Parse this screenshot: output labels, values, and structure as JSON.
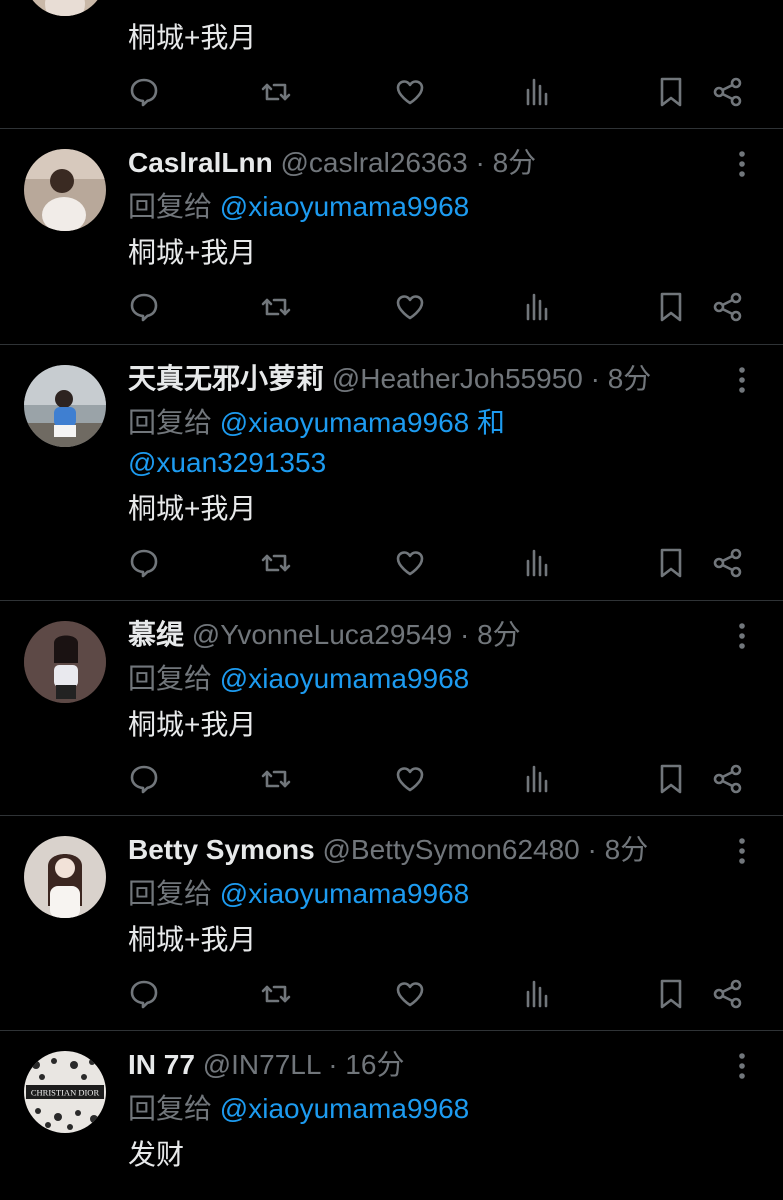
{
  "colors": {
    "background": "#000000",
    "text": "#e7e9ea",
    "muted": "#71767b",
    "link": "#1d9bf0",
    "divider": "#2f3336"
  },
  "top_partial": {
    "text": "桐城+我月"
  },
  "replies": [
    {
      "name": "CaslralLnn",
      "handle": "@caslral26363",
      "separator": "·",
      "time": "8分",
      "reply_prefix": "回复给",
      "mentions": [
        "@xiaoyumama9968"
      ],
      "text": "桐城+我月"
    },
    {
      "name": "天真无邪小萝莉",
      "handle": "@HeatherJoh55950",
      "separator": "·",
      "time": "8分",
      "reply_prefix": "回复给",
      "mentions": [
        "@xiaoyumama9968",
        "@xuan3291353"
      ],
      "mention_joiner": "和",
      "text": "桐城+我月"
    },
    {
      "name": "慕缇",
      "handle": "@YvonneLuca29549",
      "separator": "·",
      "time": "8分",
      "reply_prefix": "回复给",
      "mentions": [
        "@xiaoyumama9968"
      ],
      "text": "桐城+我月"
    },
    {
      "name": "Betty Symons",
      "handle": "@BettySymon62480",
      "separator": "·",
      "time": "8分",
      "reply_prefix": "回复给",
      "mentions": [
        "@xiaoyumama9968"
      ],
      "text": "桐城+我月"
    },
    {
      "name": "IN 77",
      "handle": "@IN77LL",
      "separator": "·",
      "time": "16分",
      "reply_prefix": "回复给",
      "mentions": [
        "@xiaoyumama9968"
      ],
      "text": "发财",
      "avatar_text": "CHRISTIAN DIOR"
    }
  ],
  "action_icons": [
    "reply-icon",
    "retweet-icon",
    "like-icon",
    "views-icon",
    "bookmark-icon",
    "share-icon"
  ]
}
